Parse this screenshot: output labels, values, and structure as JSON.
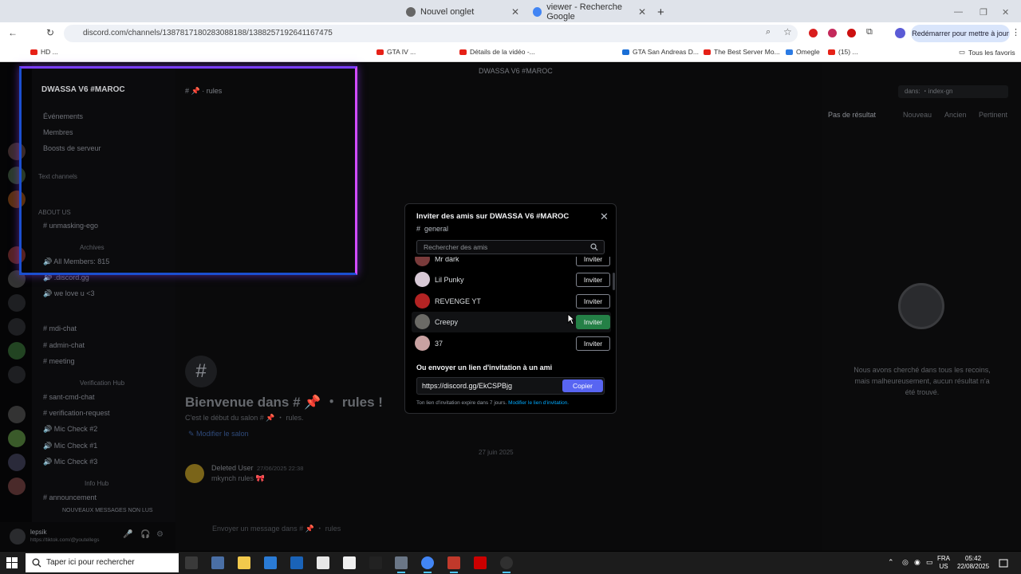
{
  "browser": {
    "tabs": [
      {
        "label": "Nouvel onglet"
      },
      {
        "label": "viewer - Recherche Google"
      }
    ],
    "url": "discord.com/channels/1387817180283088188/1388257192641167475",
    "restart_label": "Redémarrer pour mettre à jour",
    "bookmarks": [
      "HD ...",
      "GTA IV ...",
      "Détails de la vidéo -...",
      "GTA San Andreas D...",
      "The Best Server Mo...",
      "Omegle",
      "(15) ..."
    ],
    "all_bookmarks_label": "Tous les favoris"
  },
  "discord": {
    "top_title": "DWASSA V6 #MAROC",
    "server_name": "DWASSA V6 #MAROC",
    "sidebar_items": [
      "Événements",
      "Membres",
      "Boosts de serveur"
    ],
    "categories": [
      "Text channels",
      "ABOUT US",
      "Archives",
      "Verification Hub",
      "Info Hub"
    ],
    "channels": [
      "unmasking-ego",
      "All Members: 815",
      ".discord.gg",
      "we love u <3",
      "mdi-chat",
      "admin-chat",
      "meeting",
      "sant-cmd-chat",
      "verification-request",
      "Mic Check #2",
      "Mic Check #1",
      "Mic Check #3",
      "announcement"
    ],
    "new_messages_label": "NOUVEAUX MESSAGES NON LUS",
    "user": {
      "name": "lepsik",
      "status": "https://tiktok.com/@youtellegs"
    },
    "channel_header": "rules",
    "welcome_title": "Bienvenue dans # 📌 ・ rules !",
    "welcome_sub": "C'est le début du salon # 📌 ・ rules.",
    "edit_channel": "Modifier le salon",
    "date_divider": "27 juin 2025",
    "message": {
      "author": "Deleted User",
      "time": "27/06/2025 22:38",
      "text": "mkynch rules 🎀"
    },
    "input_placeholder": "Envoyer un message dans # 📌 ・ rules",
    "search": {
      "query": "dans: ・index-gn",
      "no_result": "Pas de résultat",
      "filters": [
        "Nouveau",
        "Ancien",
        "Pertinent"
      ],
      "empty_text": "Nous avons cherché dans tous les recoins, mais malheureusement, aucun résultat n'a été trouvé."
    }
  },
  "invite_modal": {
    "title": "Inviter des amis sur DWASSA V6 #MAROC",
    "channel": "general",
    "search_placeholder": "Rechercher des amis",
    "invite_label": "Inviter",
    "friends": [
      {
        "name": "Mr dark",
        "color": "#7a3b3b"
      },
      {
        "name": "Lil Punky",
        "color": "#d8c9d6"
      },
      {
        "name": "REVENGE YT",
        "color": "#b32323"
      },
      {
        "name": "Creepy",
        "color": "#6b6a66"
      },
      {
        "name": "37",
        "color": "#c9a2a2"
      }
    ],
    "link_label": "Ou envoyer un lien d'invitation à un ami",
    "link": "https://discord.gg/EkCSPBjg",
    "copy_label": "Copier",
    "expire_note": "Ton lien d'invitation expire dans 7 jours.",
    "expire_link": "Modifier le lien d'invitation."
  },
  "taskbar": {
    "search_placeholder": "Taper ici pour rechercher",
    "lang": "FRA",
    "region": "US",
    "time": "05:42",
    "date": "22/08/2025"
  },
  "colors": {
    "accent": "#5865f2",
    "invite_active": "#248046",
    "link": "#00a8fc"
  }
}
